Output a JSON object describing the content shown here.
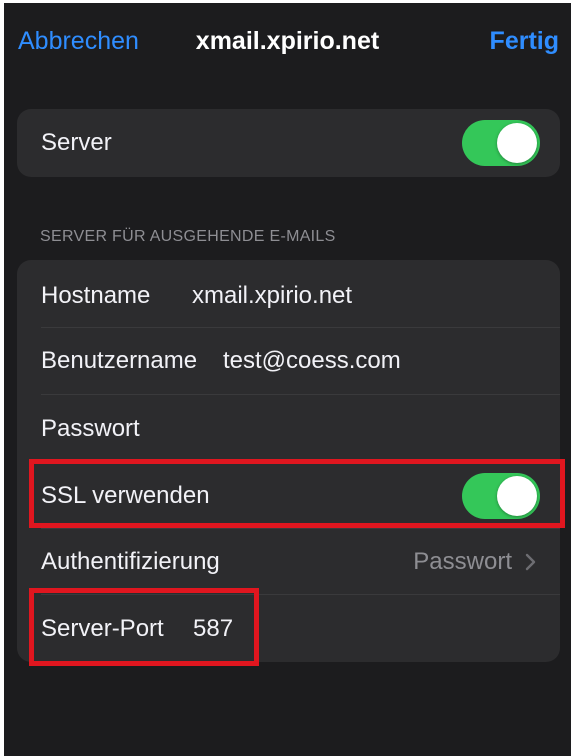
{
  "nav": {
    "cancel_label": "Abbrechen",
    "title": "xmail.xpirio.net",
    "done_label": "Fertig"
  },
  "server_group": {
    "server_label": "Server",
    "server_enabled": true
  },
  "outgoing": {
    "section_header": "SERVER FÜR AUSGEHENDE E-MAILS",
    "hostname_label": "Hostname",
    "hostname_value": "xmail.xpirio.net",
    "username_label": "Benutzername",
    "username_value": "test@coess.com",
    "password_label": "Passwort",
    "ssl_label": "SSL verwenden",
    "ssl_enabled": true,
    "auth_label": "Authentifizierung",
    "auth_value": "Passwort",
    "port_label": "Server-Port",
    "port_value": "587"
  },
  "colors": {
    "accent": "#2f8dff",
    "toggle_on": "#34c759",
    "highlight": "#e0161f",
    "background": "#1c1c1e",
    "cell": "#2c2c2e"
  },
  "icons": {
    "disclosure": "chevron-right-icon"
  }
}
